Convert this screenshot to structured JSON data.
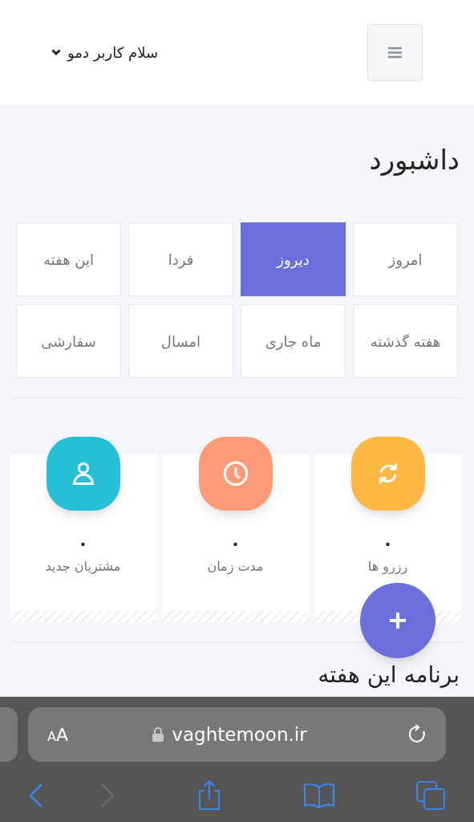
{
  "header": {
    "greeting": "سلام کاربر دمو"
  },
  "page_title": "داشبورد",
  "periods": [
    {
      "label": "امروز",
      "selected": false
    },
    {
      "label": "دیروز",
      "selected": true
    },
    {
      "label": "فردا",
      "selected": false
    },
    {
      "label": "این هفته",
      "selected": false
    },
    {
      "label": "هفته گذشته",
      "selected": false
    },
    {
      "label": "ماه جاری",
      "selected": false
    },
    {
      "label": "امسال",
      "selected": false
    },
    {
      "label": "سفارشی",
      "selected": false
    }
  ],
  "stats": [
    {
      "kind": "refresh",
      "color": "#fdb844",
      "value": "۰",
      "label": "رزرو ها"
    },
    {
      "kind": "clock",
      "color": "#fd9a77",
      "value": "۰",
      "label": "مدت زمان"
    },
    {
      "kind": "user",
      "color": "#26bfd7",
      "value": "۰",
      "label": "مشتریان جدید"
    }
  ],
  "section_title": "برنامه این هفته",
  "browser": {
    "text_size": "AA",
    "url": "vaghtemoon.ir"
  }
}
